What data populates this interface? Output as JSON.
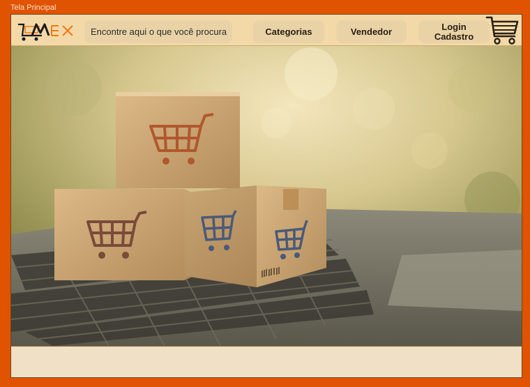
{
  "window": {
    "title": "Tela Principal"
  },
  "header": {
    "logo_text": "MEX",
    "search_placeholder": "Encontre aqui o que você procura",
    "nav": {
      "categorias": "Categorias",
      "vendedor": "Vendedor",
      "login": "Login",
      "cadastro": "Cadastro"
    }
  },
  "icons": {
    "logo": "cart-logo-icon",
    "cart": "shopping-cart-icon"
  },
  "colors": {
    "background": "#E05300",
    "header": "#F4D9A8",
    "button": "#E9D2A6",
    "footer": "#EFE0C6",
    "logo_dark": "#1a1a1a",
    "logo_orange": "#F07A1A"
  }
}
